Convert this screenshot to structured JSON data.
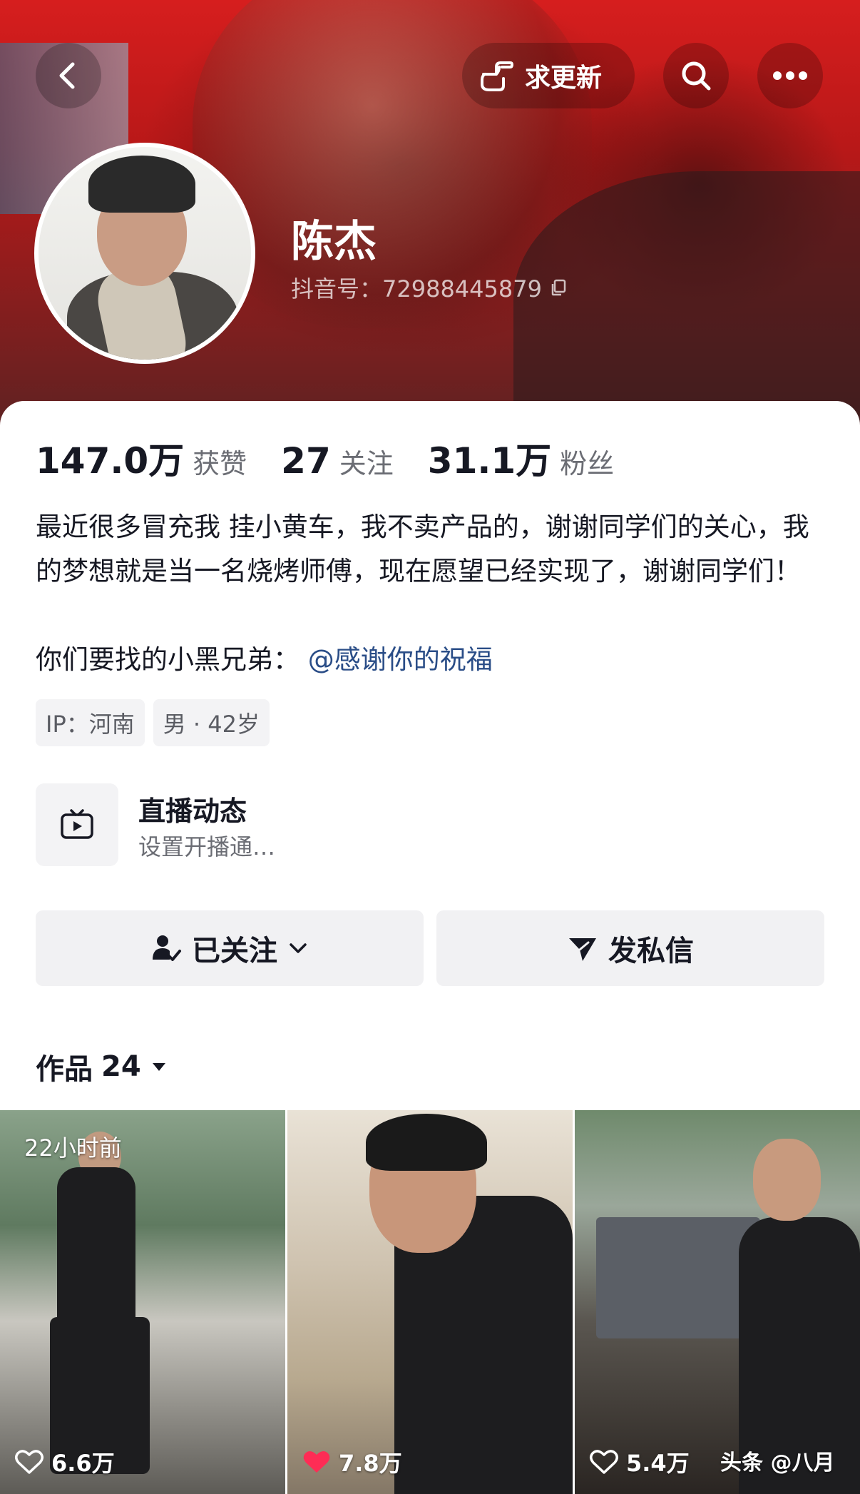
{
  "header": {
    "update_label": "求更新"
  },
  "profile": {
    "name": "陈杰",
    "douyin_id": "抖音号：72988445879"
  },
  "stats": [
    {
      "value": "147.0万",
      "label": "获赞"
    },
    {
      "value": "27",
      "label": "关注"
    },
    {
      "value": "31.1万",
      "label": "粉丝"
    }
  ],
  "bio": {
    "text": "最近很多冒充我 挂小黄车，我不卖产品的，谢谢同学们的关心，我的梦想就是当一名烧烤师傅，现在愿望已经实现了，谢谢同学们！",
    "line2_prefix": "你们要找的小黑兄弟：",
    "mention": "@感谢你的祝福"
  },
  "tags": [
    "IP：河南",
    "男 · 42岁"
  ],
  "live": {
    "title": "直播动态",
    "subtitle": "设置开播通…"
  },
  "actions": {
    "follow_label": "已关注",
    "message_label": "发私信"
  },
  "works": {
    "label": "作品",
    "count": "24"
  },
  "videos": [
    {
      "time": "22小时前",
      "likes": "6.6万",
      "liked": false
    },
    {
      "time": "",
      "likes": "7.8万",
      "liked": true
    },
    {
      "time": "",
      "likes": "5.4万",
      "liked": false
    }
  ],
  "watermark": "头条 @八月",
  "colors": {
    "banner_red": "#d61e1e",
    "mention_blue": "#2a4d87",
    "liked_pink": "#fe2c55"
  }
}
